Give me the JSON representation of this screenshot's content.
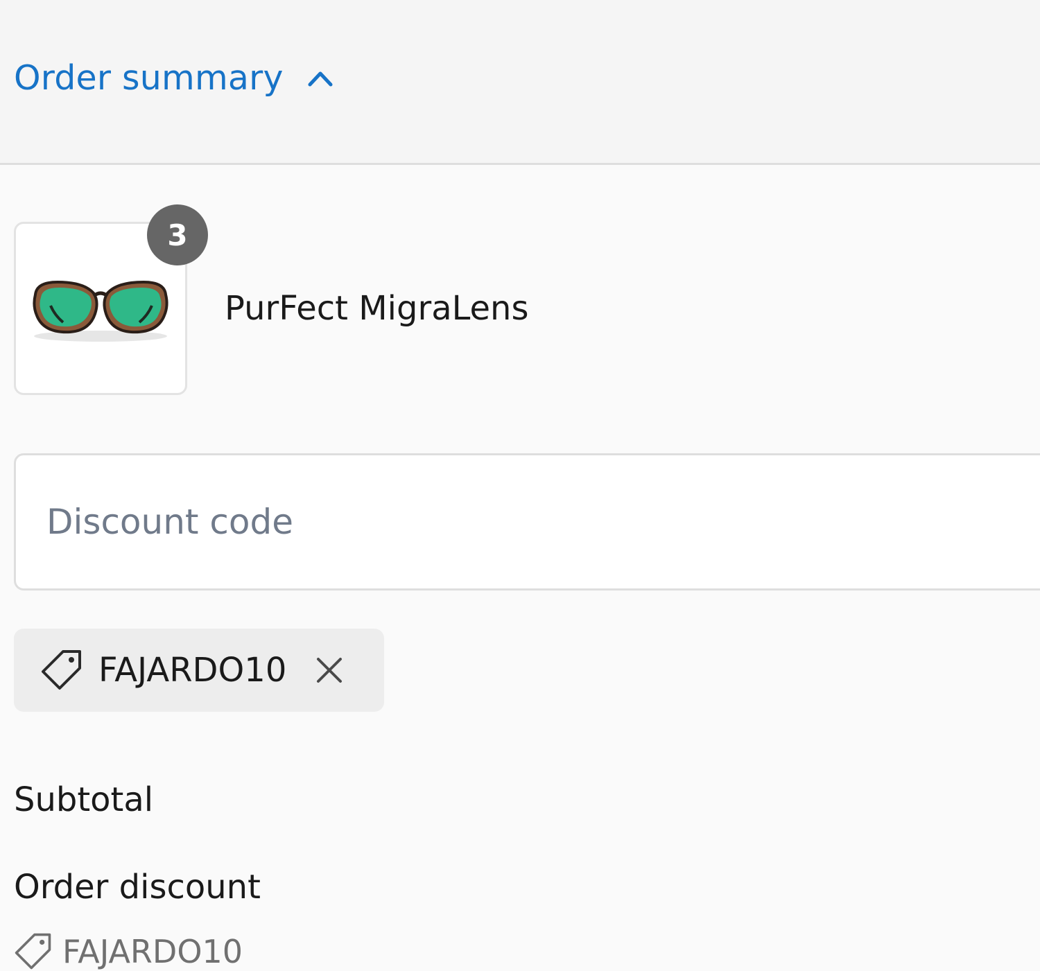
{
  "header": {
    "toggle_label": "Order summary",
    "toggle_icon": "chevron-up-icon",
    "accent_color": "#1773c7"
  },
  "line_item": {
    "product_name": "PurFect MigraLens",
    "quantity": "3",
    "image_icon": "sunglasses-image"
  },
  "discount": {
    "placeholder": "Discount code",
    "value": "",
    "applied_code": "FAJARDO10",
    "tag_icon": "tag-icon",
    "remove_icon": "close-icon"
  },
  "totals": {
    "subtotal_label": "Subtotal",
    "order_discount_label": "Order discount",
    "order_discount_code": "FAJARDO10"
  }
}
